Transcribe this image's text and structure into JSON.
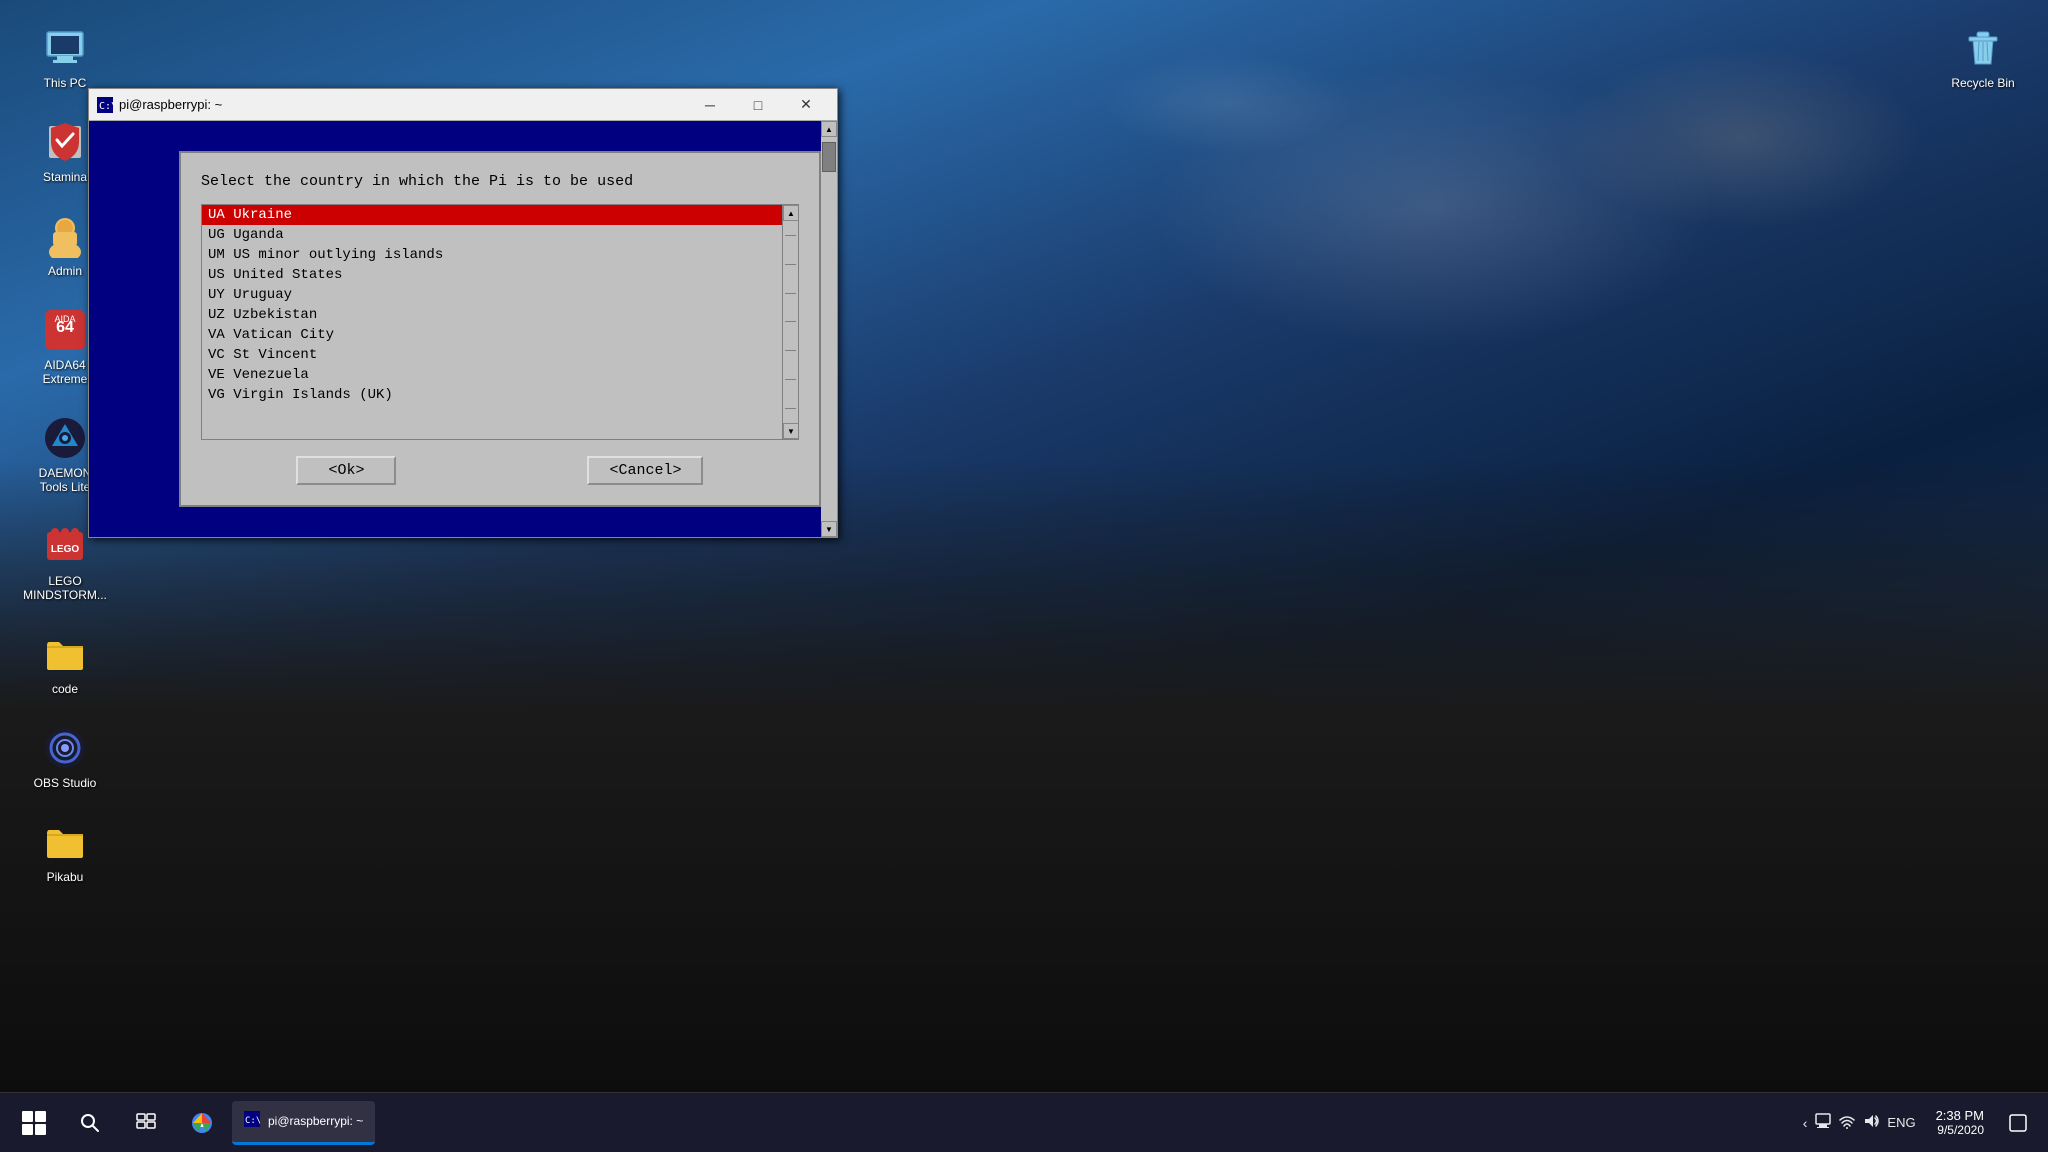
{
  "desktop": {
    "background_desc": "Ocean landscape with rocky coastline and dramatic sky"
  },
  "desktop_icons": {
    "left_column": [
      {
        "id": "this-pc",
        "label": "This PC",
        "icon": "💻"
      },
      {
        "id": "stamina",
        "label": "Stamina",
        "icon": "🦷"
      },
      {
        "id": "admin",
        "label": "Admin",
        "icon": "👤"
      },
      {
        "id": "aida64",
        "label": "AIDA64\nExtreme",
        "label1": "AIDA64",
        "label2": "Extreme",
        "icon": "⚙"
      },
      {
        "id": "daemon",
        "label": "DAEMON\nTools Lite",
        "label1": "DAEMON",
        "label2": "Tools Lite",
        "icon": "⚡"
      },
      {
        "id": "lego",
        "label": "LEGO\nMINDSTOR...",
        "label1": "LEGO",
        "label2": "MINDSTORM...",
        "icon": "🧱"
      },
      {
        "id": "code",
        "label": "code",
        "icon": "📁"
      },
      {
        "id": "obs",
        "label": "OBS Studio",
        "icon": "⏺"
      },
      {
        "id": "pikabu",
        "label": "Pikabu",
        "icon": "📁"
      }
    ],
    "right_column": [
      {
        "id": "recycle",
        "label": "Recycle Bin",
        "icon": "🗑"
      }
    ]
  },
  "terminal": {
    "title": "pi@raspberrypi: ~",
    "icon": "🖥",
    "minimize_label": "─",
    "maximize_label": "□",
    "close_label": "✕"
  },
  "dialog": {
    "prompt": "Select the country in which the Pi is to be used",
    "items": [
      {
        "code": "UA",
        "name": "Ukraine",
        "selected": true
      },
      {
        "code": "UG",
        "name": "Uganda",
        "selected": false
      },
      {
        "code": "UM",
        "name": "US minor outlying islands",
        "selected": false
      },
      {
        "code": "US",
        "name": "United States",
        "selected": false
      },
      {
        "code": "UY",
        "name": "Uruguay",
        "selected": false
      },
      {
        "code": "UZ",
        "name": "Uzbekistan",
        "selected": false
      },
      {
        "code": "VA",
        "name": "Vatican City",
        "selected": false
      },
      {
        "code": "VC",
        "name": "St Vincent",
        "selected": false
      },
      {
        "code": "VE",
        "name": "Venezuela",
        "selected": false
      },
      {
        "code": "VG",
        "name": "Virgin Islands (UK)",
        "selected": false
      }
    ],
    "ok_label": "<Ok>",
    "cancel_label": "<Cancel>"
  },
  "taskbar": {
    "start_label": "Start",
    "search_label": "Search",
    "active_app": "pi@raspberrypi: ~",
    "tray": {
      "show_hidden": "^",
      "network_icon": "🌐",
      "wifi_icon": "📶",
      "volume_icon": "🔊",
      "language": "ENG",
      "time": "2:38 PM",
      "date": "9/5/2020",
      "notification": "💬"
    }
  }
}
